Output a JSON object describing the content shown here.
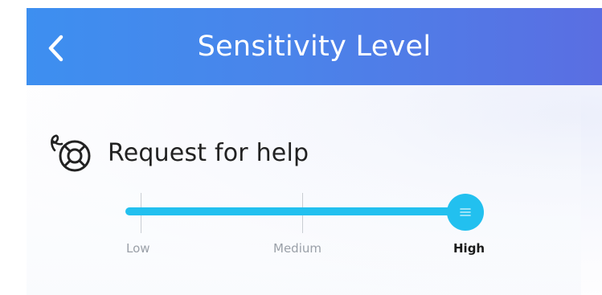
{
  "header": {
    "title": "Sensitivity Level",
    "back_icon": "chevron-left-icon"
  },
  "setting": {
    "icon": "lifebuoy-icon",
    "label": "Request for help"
  },
  "slider": {
    "levels": [
      "Low",
      "Medium",
      "High"
    ],
    "selected": "High",
    "selected_index": 2,
    "thumb_icon": "menu-lines-icon"
  },
  "colors": {
    "header_start": "#3d8ff0",
    "header_end": "#5a6ee2",
    "slider_accent": "#22c0ef",
    "inactive_label": "#9aa0a8",
    "active_label": "#1a1a1a"
  }
}
